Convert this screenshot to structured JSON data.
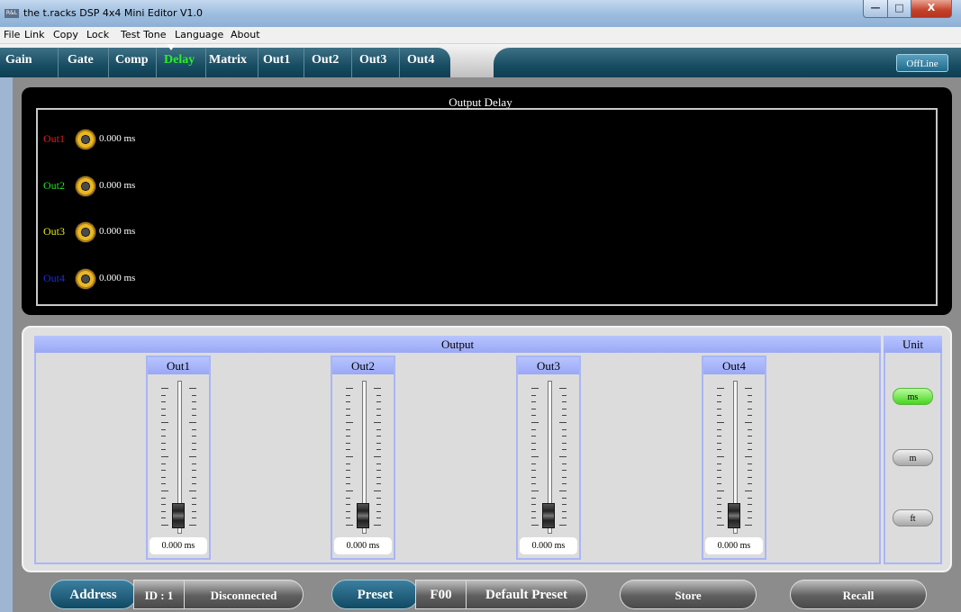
{
  "window": {
    "title": "the t.racks DSP 4x4 Mini Editor V1.0",
    "icon_text": "R&L",
    "minimize": "—",
    "maximize": "□",
    "close": "X"
  },
  "menu": [
    "File",
    "Link",
    "Copy",
    "Lock",
    "Test Tone",
    "Language",
    "About"
  ],
  "tabs": [
    {
      "label": "Gain",
      "active": false
    },
    {
      "label": "Gate",
      "active": false
    },
    {
      "label": "Comp",
      "active": false
    },
    {
      "label": "Delay",
      "active": true
    },
    {
      "label": "Matrix",
      "active": false
    },
    {
      "label": "Out1",
      "active": false
    },
    {
      "label": "Out2",
      "active": false
    },
    {
      "label": "Out3",
      "active": false
    },
    {
      "label": "Out4",
      "active": false
    }
  ],
  "status_button": "OffLine",
  "delay_panel": {
    "title": "Output Delay",
    "rows": [
      {
        "label": "Out1",
        "color": "#e21b1b",
        "value": "0.000 ms"
      },
      {
        "label": "Out2",
        "color": "#23e023",
        "value": "0.000 ms"
      },
      {
        "label": "Out3",
        "color": "#e6e626",
        "value": "0.000 ms"
      },
      {
        "label": "Out4",
        "color": "#1c2cd8",
        "value": "0.000 ms"
      }
    ]
  },
  "output_panel": {
    "title": "Output",
    "faders": [
      {
        "label": "Out1",
        "value": "0.000 ms",
        "level": 0
      },
      {
        "label": "Out2",
        "value": "0.000 ms",
        "level": 0
      },
      {
        "label": "Out3",
        "value": "0.000 ms",
        "level": 0
      },
      {
        "label": "Out4",
        "value": "0.000 ms",
        "level": 0
      }
    ]
  },
  "unit_panel": {
    "title": "Unit",
    "options": [
      {
        "label": "ms",
        "selected": true
      },
      {
        "label": "m",
        "selected": false
      },
      {
        "label": "ft",
        "selected": false
      }
    ]
  },
  "footer": {
    "address_label": "Address",
    "id_value": "ID : 1",
    "connection_status": "Disconnected",
    "preset_label": "Preset",
    "preset_code": "F00",
    "preset_name": "Default Preset",
    "store_label": "Store",
    "recall_label": "Recall"
  }
}
